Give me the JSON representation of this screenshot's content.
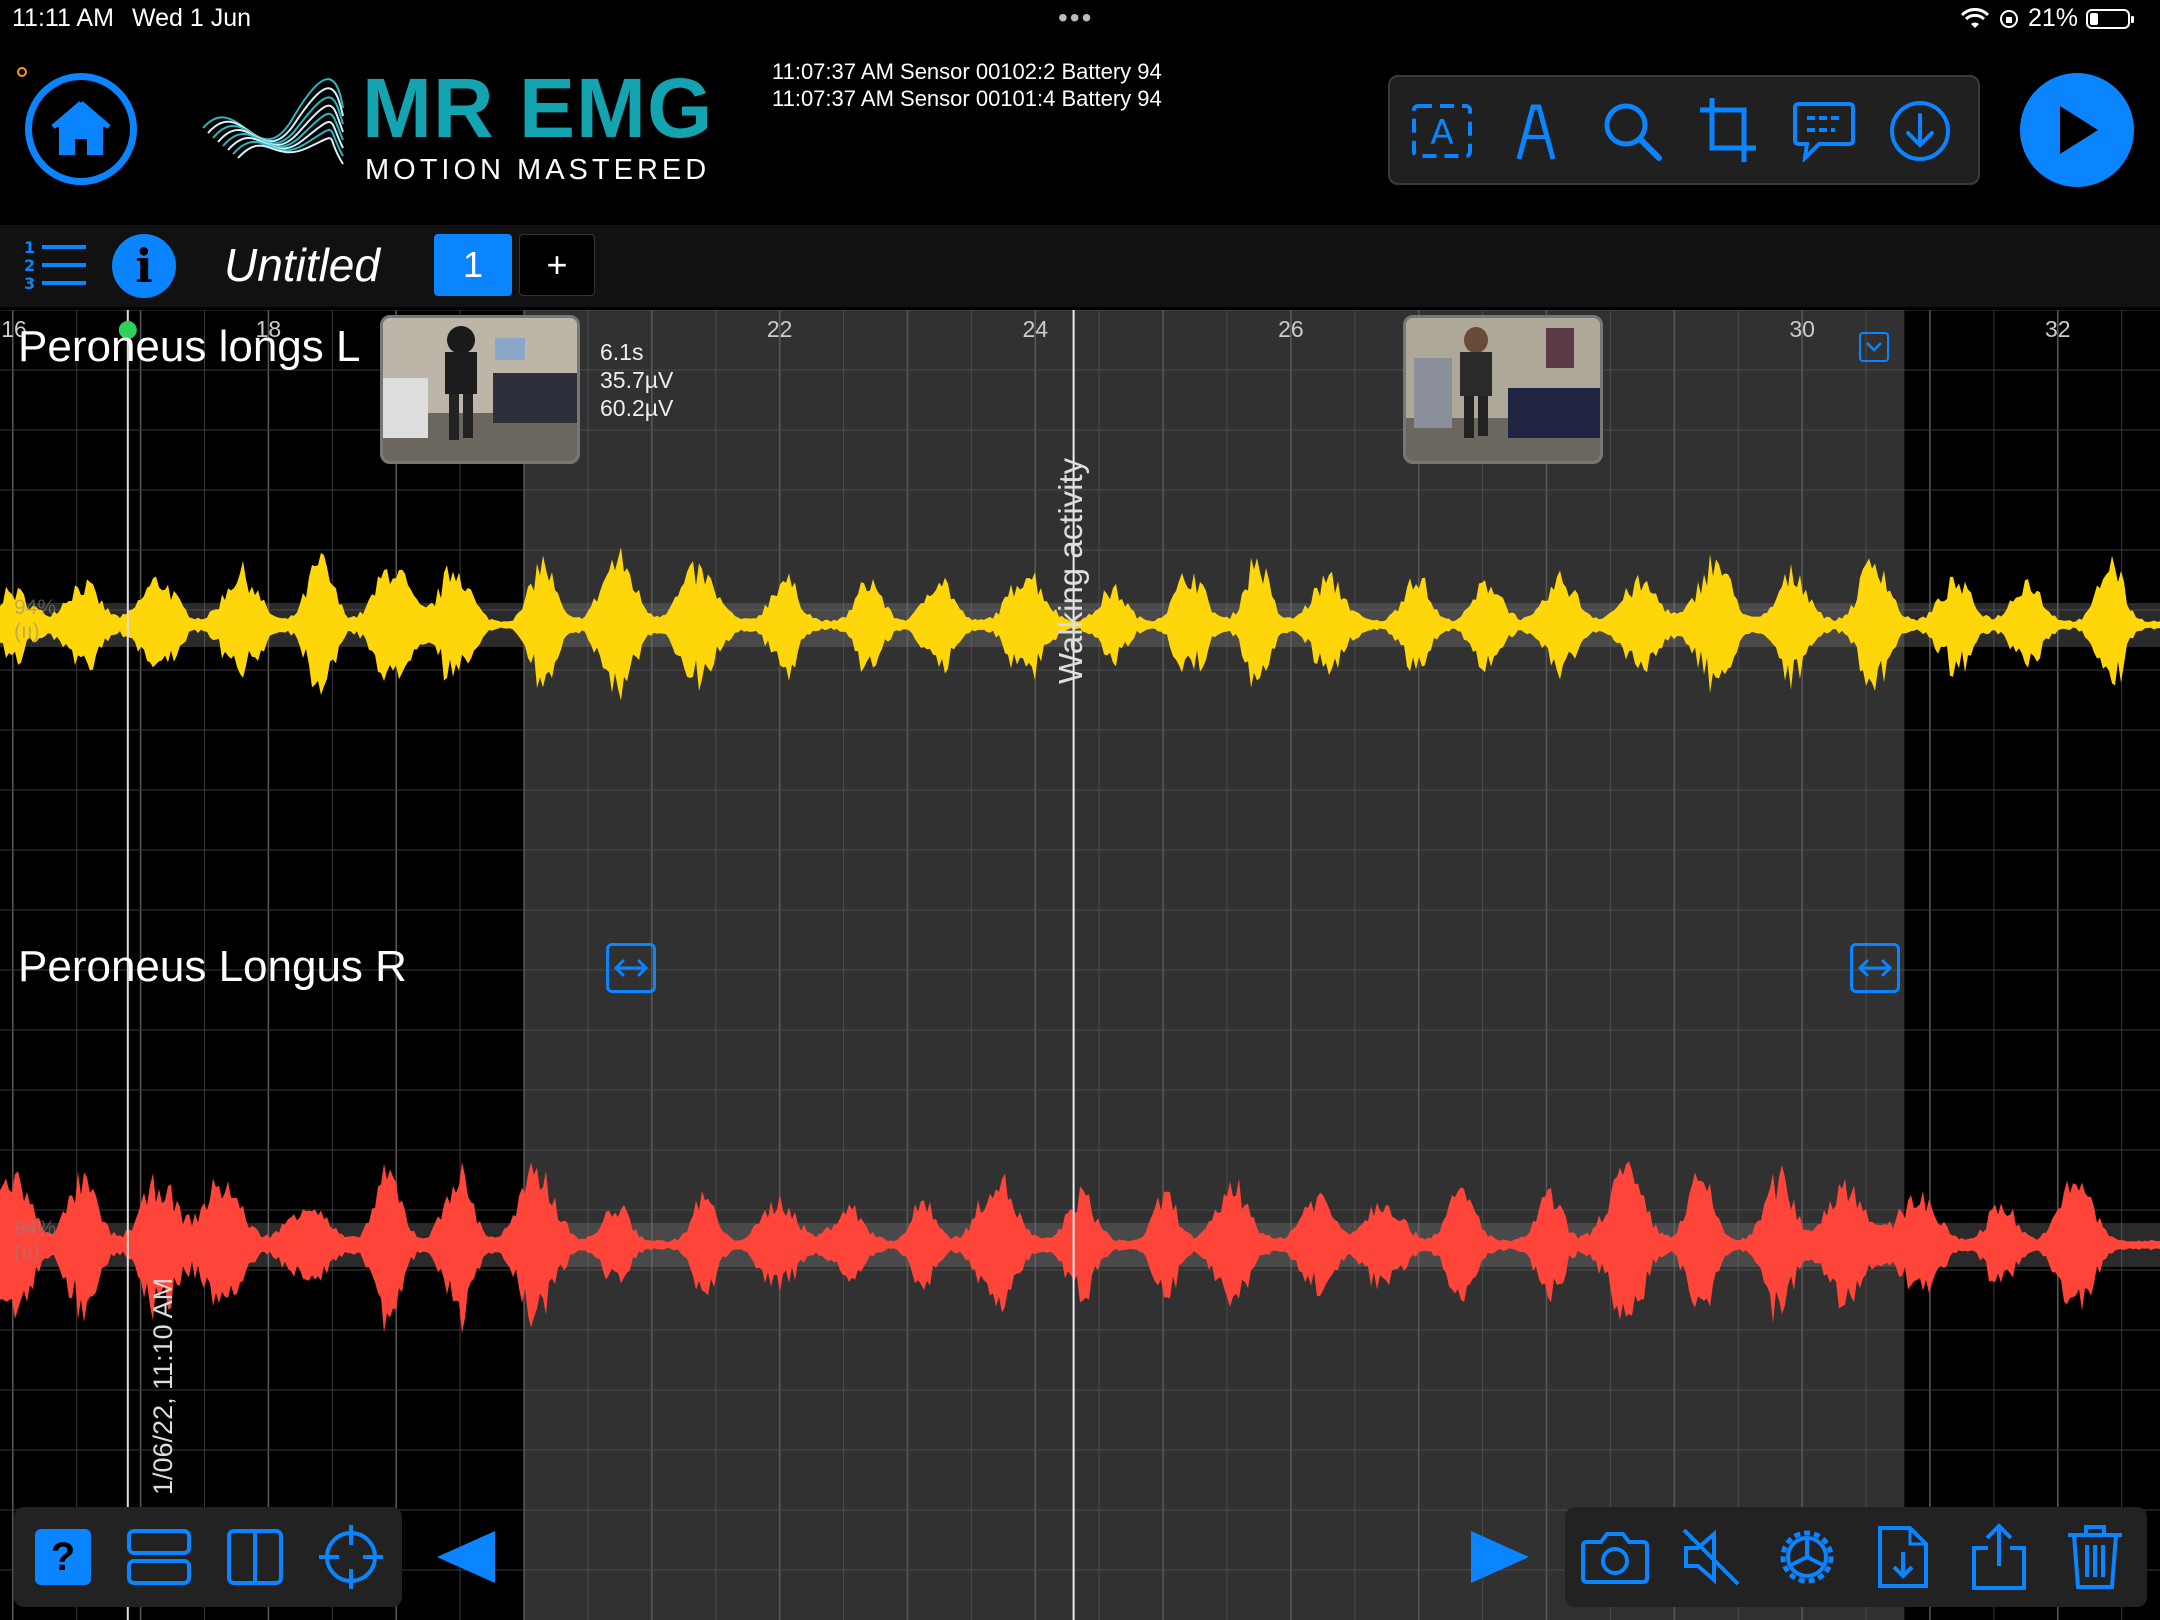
{
  "status_bar": {
    "time": "11:11 AM",
    "date": "Wed 1 Jun",
    "dots": "•••",
    "battery": "21%"
  },
  "header": {
    "brand_title": "MR EMG",
    "brand_subtitle": "MOTION MASTERED",
    "log_lines": [
      "11:07:37 AM Sensor 00102:2 Battery 94",
      "11:07:37 AM Sensor 00101:4 Battery 94"
    ],
    "toolbar_icons": [
      "text-annotation-icon",
      "pen-icon",
      "search-icon",
      "crop-icon",
      "comment-icon",
      "download-icon"
    ],
    "play_icon": "play-icon"
  },
  "doc_bar": {
    "title": "Untitled",
    "page_tab": "1",
    "add_label": "+"
  },
  "plot": {
    "time_ticks": [
      "16",
      "18",
      "22",
      "24",
      "26",
      "30",
      "32"
    ],
    "channels": [
      {
        "name": "Peroneus longs L",
        "color": "#ffd60a",
        "battery_badge": "94%",
        "signal_badge": "(ıı)"
      },
      {
        "name": "Peroneus Longus R",
        "color": "#ff453a",
        "battery_badge": "94%",
        "signal_badge": "(ıı)"
      }
    ],
    "readout": {
      "duration": "6.1s",
      "value1": "35.7µV",
      "value2": "60.2µV"
    },
    "activity_label": "Walking activity",
    "timestamp_label": "1/06/22, 11:10 AM",
    "selection": {
      "start_s": 20.0,
      "end_s": 30.8
    },
    "cursor_s": 24.3,
    "marker_s": 16.9,
    "visible_range_s": [
      15.9,
      32.8
    ]
  },
  "bottom_left_icons": [
    "help-icon",
    "rows-layout-icon",
    "columns-layout-icon",
    "target-icon",
    "previous-icon"
  ],
  "bottom_right_icons": [
    "next-icon",
    "camera-icon",
    "mute-icon",
    "settings-icon",
    "export-file-icon",
    "share-icon",
    "trash-icon"
  ],
  "help_label": "?"
}
